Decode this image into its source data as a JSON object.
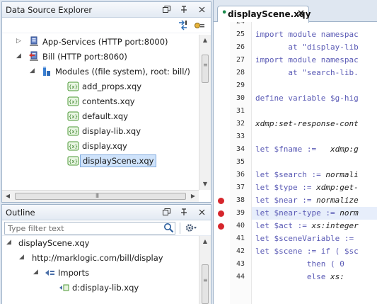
{
  "dse": {
    "title": "Data Source Explorer",
    "items": [
      {
        "label": "App-Services (HTTP port:8000)",
        "twisty": "▷",
        "icon": "server-icon"
      },
      {
        "label": "Bill (HTTP port:8060)",
        "twisty": "◢",
        "icon": "server-active-icon"
      },
      {
        "label": "Modules ((file system), root: bill/)",
        "twisty": "◢",
        "icon": "modules-folder-icon"
      },
      {
        "label": "add_props.xqy",
        "twisty": "",
        "icon": "xquery-file-icon"
      },
      {
        "label": "contents.xqy",
        "twisty": "",
        "icon": "xquery-file-icon"
      },
      {
        "label": "default.xqy",
        "twisty": "",
        "icon": "xquery-file-icon"
      },
      {
        "label": "display-lib.xqy",
        "twisty": "",
        "icon": "xquery-file-icon"
      },
      {
        "label": "display.xqy",
        "twisty": "",
        "icon": "xquery-file-icon"
      },
      {
        "label": "displayScene.xqy",
        "twisty": "",
        "icon": "xquery-file-icon",
        "selected": true
      }
    ],
    "hscroll_grip": "III"
  },
  "outline": {
    "title": "Outline",
    "filter_placeholder": "Type filter text",
    "items": [
      {
        "label": "displayScene.xqy",
        "twisty": "◢"
      },
      {
        "label": "http://marklogic.com/bill/display",
        "twisty": "◢"
      },
      {
        "label": "Imports",
        "twisty": "◢",
        "icon": "imports-icon"
      },
      {
        "label": "d:display-lib.xqy",
        "twisty": "",
        "icon": "import-item-icon"
      }
    ]
  },
  "editor": {
    "tab_label": "displayScene.xqy",
    "tab_dot": "•",
    "lines": [
      {
        "num": "24",
        "text": ""
      },
      {
        "num": "25",
        "parts": [
          {
            "t": "import module namespac",
            "c": "kw"
          }
        ]
      },
      {
        "num": "26",
        "parts": [
          {
            "t": "       at \"display-lib",
            "c": "kw"
          }
        ]
      },
      {
        "num": "27",
        "parts": [
          {
            "t": "import module namespac",
            "c": "kw"
          }
        ]
      },
      {
        "num": "28",
        "parts": [
          {
            "t": "       at \"search-lib.",
            "c": "kw"
          }
        ]
      },
      {
        "num": "29",
        "text": ""
      },
      {
        "num": "30",
        "parts": [
          {
            "t": "define variable $g-hig",
            "c": "kw"
          }
        ]
      },
      {
        "num": "31",
        "text": ""
      },
      {
        "num": "32",
        "parts": [
          {
            "t": "xdmp:set-response-cont",
            "c": "it"
          }
        ]
      },
      {
        "num": "33",
        "text": ""
      },
      {
        "num": "34",
        "parts": [
          {
            "t": "let $fname :=   ",
            "c": "kw"
          },
          {
            "t": "xdmp:g",
            "c": "it"
          }
        ]
      },
      {
        "num": "35",
        "text": ""
      },
      {
        "num": "36",
        "parts": [
          {
            "t": "let $search := ",
            "c": "kw"
          },
          {
            "t": "normali",
            "c": "it"
          }
        ]
      },
      {
        "num": "37",
        "parts": [
          {
            "t": "let $type := ",
            "c": "kw"
          },
          {
            "t": "xdmp:get-",
            "c": "it"
          }
        ]
      },
      {
        "num": "38",
        "parts": [
          {
            "t": "let $near := ",
            "c": "kw"
          },
          {
            "t": "normalize",
            "c": "it"
          }
        ],
        "bp": true
      },
      {
        "num": "39",
        "parts": [
          {
            "t": "let $near-type := ",
            "c": "kw"
          },
          {
            "t": "norm",
            "c": "it"
          }
        ],
        "bp": true,
        "hl": true
      },
      {
        "num": "40",
        "parts": [
          {
            "t": "let $act := ",
            "c": "kw"
          },
          {
            "t": "xs:integer",
            "c": "it"
          }
        ],
        "bp": true
      },
      {
        "num": "41",
        "parts": [
          {
            "t": "let $sceneVariable := ",
            "c": "kw"
          }
        ]
      },
      {
        "num": "42",
        "parts": [
          {
            "t": "let $scene := if ( $sc",
            "c": "kw"
          }
        ]
      },
      {
        "num": "43",
        "parts": [
          {
            "t": "           then ( 0",
            "c": "kw"
          }
        ]
      },
      {
        "num": "44",
        "parts": [
          {
            "t": "           else ",
            "c": "kw"
          },
          {
            "t": "xs:",
            "c": "it"
          }
        ]
      }
    ]
  }
}
